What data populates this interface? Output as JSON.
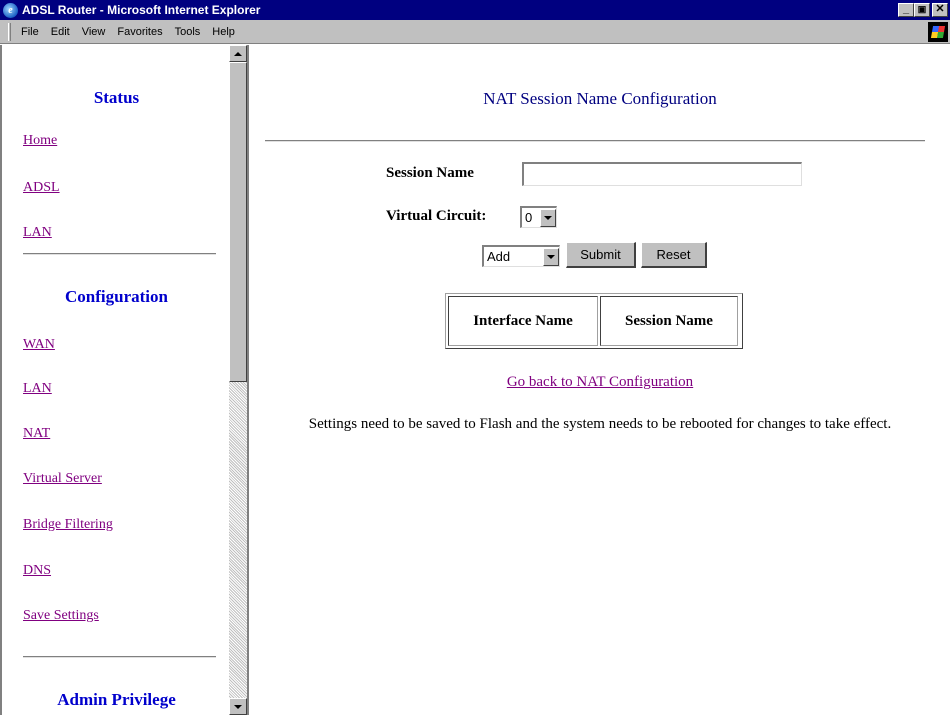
{
  "window": {
    "title": "ADSL Router - Microsoft Internet Explorer",
    "minimize": "_",
    "maximize": "▫",
    "close": "×"
  },
  "menu": {
    "file": "File",
    "edit": "Edit",
    "view": "View",
    "favorites": "Favorites",
    "tools": "Tools",
    "help": "Help"
  },
  "nav": {
    "status_heading": "Status",
    "status_links": [
      "Home",
      "ADSL",
      "LAN"
    ],
    "configuration_heading": "Configuration",
    "configuration_links": [
      "WAN",
      "LAN",
      "NAT",
      "Virtual Server",
      "Bridge Filtering",
      "DNS",
      "Save Settings"
    ],
    "admin_heading": "Admin Privilege"
  },
  "main": {
    "title": "NAT Session Name Configuration",
    "session_name_label": "Session Name",
    "session_name_value": "",
    "virtual_circuit_label": "Virtual Circuit:",
    "virtual_circuit_value": "0",
    "action_value": "Add",
    "submit_label": "Submit",
    "reset_label": "Reset",
    "table_headers": [
      "Interface Name",
      "Session Name"
    ],
    "back_link": "Go back to NAT Configuration",
    "note": "Settings need to be saved to Flash and the system needs to be rebooted for changes to take effect."
  },
  "colors": {
    "titlebar": "#000080",
    "nav_heading": "#0000cc",
    "visited_link": "#800080",
    "page_title": "#000080"
  }
}
